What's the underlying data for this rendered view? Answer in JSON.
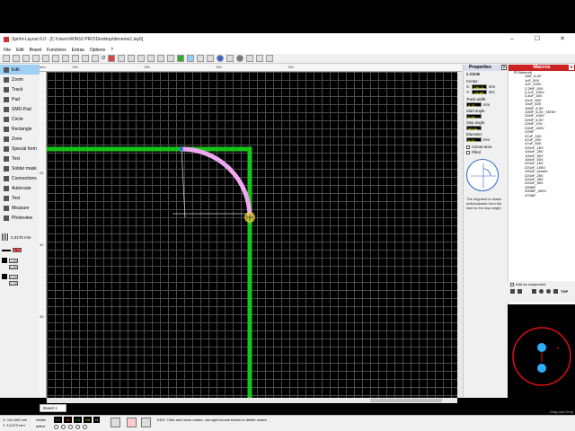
{
  "window": {
    "title": "Sprint-Layout 6.0 - [C:\\Users\\WIN10 PRO\\Desktop\\deneme1.lay6]",
    "controls": [
      "–",
      "☐",
      "✕"
    ]
  },
  "menu": [
    "File",
    "Edit",
    "Board",
    "Functions",
    "Extras",
    "Options",
    "?"
  ],
  "toolbar": {
    "step_label": "/2"
  },
  "tools": [
    "Edit",
    "Zoom",
    "Track",
    "Pad",
    "SMD-Pad",
    "Circle",
    "Rectangle",
    "Zone",
    "Special form",
    "Text",
    "Solder mask",
    "Connections",
    "Autoroute",
    "Test",
    "Measure",
    "Photoview"
  ],
  "grid": {
    "value": "0,3175 mm"
  },
  "layer_controls": {
    "width1": "0,70",
    "a": "1,80",
    "b": "0,80",
    "c": "2,00",
    "d": "2,00"
  },
  "rulers": {
    "top": [
      "mm",
      "130",
      "135",
      "140",
      "145"
    ],
    "left": [
      "25",
      "30",
      "35"
    ]
  },
  "board_tab": "Board 1",
  "properties": {
    "header": "Properties",
    "object": "1 Circle",
    "center_label": "Center:",
    "x_label": "X:",
    "x_value": "136,11",
    "y_label": "Y:",
    "y_value": "-13,65",
    "unit": "mm",
    "track_width_label": "Track width:",
    "track_width": "0,70",
    "start_angle_label": "Start angle:",
    "start_angle": "0,00",
    "stop_angle_label": "Stop angle:",
    "stop_angle": "90,00",
    "diameter_label": "Diameter:",
    "diameter": "8,00",
    "cutout_label": "Cutout-area",
    "filled_label": "Filled",
    "description": "The segment is drawn anticlockwise from the start to the stop angle."
  },
  "macros": {
    "header": "Macros",
    "root": "Elektrolit",
    "items": [
      "1MF_6,3V",
      "1uF_50V",
      "1uF_100V",
      "2,2MF_50V",
      "2,2uF_100V",
      "3,3uF_16V",
      "10uF_50V",
      "10uF_63V",
      "10MF_6,3V",
      "10MF_6,3V_YATAY",
      "22MF_100V",
      "22MF_6,3V",
      "22MF_10V",
      "22MF_400V",
      "47MF",
      "47uF_16V",
      "47uF_25V",
      "47uF_50V",
      "100uF_16V",
      "100uF_25V",
      "100uF_50V",
      "100uF_63V",
      "220uF_16V",
      "220uF_100V",
      "100uF_simetri",
      "220uF_25V",
      "220uF_35V",
      "220uF_50V",
      "330MF",
      "330MF_400V",
      "470MF"
    ],
    "add_component_label": "Add as component",
    "top_label": "TOP",
    "preview_caption": "Drag and Drop"
  },
  "status": {
    "x": "X:  142,493 mm",
    "y": "Y:  12,673 mm",
    "visible": "visible",
    "active": "active",
    "layers": [
      "C1",
      "S1",
      "C2",
      "S2",
      "O"
    ],
    "message": "EDIT:  Click and move nodes, use right mouse button to delete nodes"
  },
  "colors": {
    "track": "#18c418",
    "arc": "#f0a8f0",
    "canvas": "#000000",
    "grid": "#4a4a4a",
    "macros_head": "#cc2222"
  }
}
